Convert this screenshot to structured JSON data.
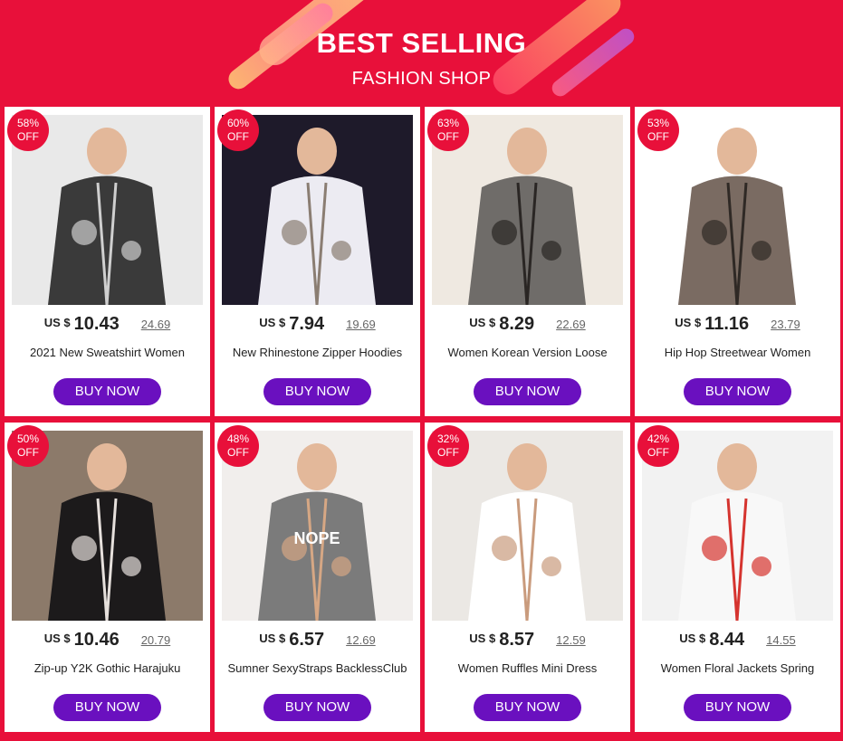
{
  "header": {
    "title": "BEST SELLING",
    "subtitle": "FASHION SHOP"
  },
  "colors": {
    "background": "#e8103a",
    "button": "#6a10bf",
    "badge": "#e8103a",
    "card": "#ffffff"
  },
  "products": [
    {
      "discount": "58%",
      "off": "OFF",
      "currency": "US $",
      "price": "10.43",
      "old_price": "24.69",
      "name": "2021 New Sweatshirt Women",
      "button": "BUY NOW",
      "photo_bg": "#e9e9e9",
      "garment": "#3a3a3a",
      "accent": "#cfcfcf"
    },
    {
      "discount": "60%",
      "off": "OFF",
      "currency": "US $",
      "price": "7.94",
      "old_price": "19.69",
      "name": "New Rhinestone Zipper Hoodies",
      "button": "BUY NOW",
      "photo_bg": "#1e1a2a",
      "garment": "#ecebf2",
      "accent": "#8a7d72"
    },
    {
      "discount": "63%",
      "off": "OFF",
      "currency": "US $",
      "price": "8.29",
      "old_price": "22.69",
      "name": "Women Korean Version Loose",
      "button": "BUY NOW",
      "photo_bg": "#efe9e1",
      "garment": "#6f6c69",
      "accent": "#2a2624"
    },
    {
      "discount": "53%",
      "off": "OFF",
      "currency": "US $",
      "price": "11.16",
      "old_price": "23.79",
      "name": "Hip Hop Streetwear Women",
      "button": "BUY NOW",
      "photo_bg": "#ffffff",
      "garment": "#7a6b62",
      "accent": "#2f2925"
    },
    {
      "discount": "50%",
      "off": "OFF",
      "currency": "US $",
      "price": "10.46",
      "old_price": "20.79",
      "name": "Zip-up Y2K Gothic Harajuku",
      "button": "BUY NOW",
      "photo_bg": "#8c7a6a",
      "garment": "#1c1a1b",
      "accent": "#e6e0dc"
    },
    {
      "discount": "48%",
      "off": "OFF",
      "currency": "US $",
      "price": "6.57",
      "old_price": "12.69",
      "name": "Sumner    SexyStraps   BacklessClub",
      "button": "BUY NOW",
      "photo_bg": "#f1eeec",
      "garment": "#7b7b7b",
      "accent": "#d6a784",
      "print": "NOPE"
    },
    {
      "discount": "32%",
      "off": "OFF",
      "currency": "US $",
      "price": "8.57",
      "old_price": "12.59",
      "name": "Women Ruffles Mini Dress",
      "button": "BUY NOW",
      "photo_bg": "#ebe8e4",
      "garment": "#ffffff",
      "accent": "#c99b7d"
    },
    {
      "discount": "42%",
      "off": "OFF",
      "currency": "US $",
      "price": "8.44",
      "old_price": "14.55",
      "name": "Women Floral Jackets Spring",
      "button": "BUY NOW",
      "photo_bg": "#f2f2f2",
      "garment": "#f8f8f8",
      "accent": "#d5342f"
    }
  ]
}
